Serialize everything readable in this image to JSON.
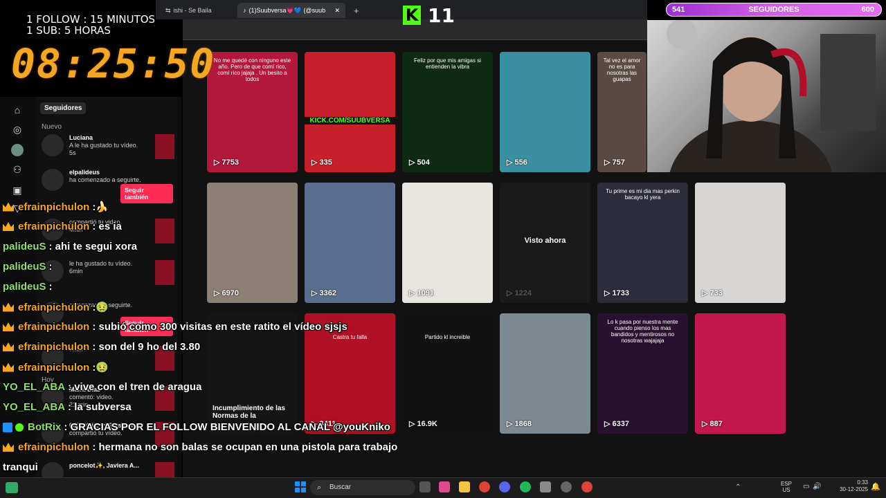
{
  "overlay": {
    "follow_line": "1 FOLLOW : 15 MINUTOS",
    "sub_line": "1 SUB: 5 HORAS",
    "timer": "08:25:50",
    "kick_count": "11",
    "goal": {
      "current": "541",
      "label": "SEGUIDORES",
      "target": "600",
      "progress_fraction": 0.9
    }
  },
  "browser": {
    "tabs": [
      {
        "label": "ishi - Se Baila"
      },
      {
        "label": "(1)Suubversa💗💙 (@suubversa)"
      }
    ],
    "new_tab": "+"
  },
  "sidebar": {
    "section": "Seguidores",
    "group_new": "Nuevo",
    "group_today": "Hoy",
    "notifications": [
      {
        "user": "Luciana",
        "text": "A le ha gustado tu vídeo.",
        "time": "5s"
      },
      {
        "user": "elpalideus",
        "text": "ha comenzado a seguirte.",
        "button": "Seguir también"
      },
      {
        "user": "",
        "text": "compartió tu video.",
        "time": "4min"
      },
      {
        "user": "",
        "text": "le ha gustado tu vídeo.",
        "time": "6min"
      },
      {
        "user": "",
        "text": "comenzado a seguirte.",
        "button": "Seguir también"
      },
      {
        "user": "",
        "text": "",
        "time": "7min"
      },
      {
        "user": "Maira Díaz",
        "text": "comentó: video.",
        "time": "21 min"
      },
      {
        "user": "080808.jk, , y 2 usuari...",
        "text": "compartió tu vídeo.",
        "time": ""
      },
      {
        "user": "poncelot✨, Javiera A...",
        "text": "",
        "time": ""
      }
    ]
  },
  "videos": [
    {
      "views": "7753",
      "caption": "No me quedé con ninguno este año. Pero de que comí rico, comí rico jajaja . Un besito a todos",
      "color": "#b3173a"
    },
    {
      "views": "335",
      "caption": "KICK.COM/SUUBVERSA",
      "color": "#c8202a"
    },
    {
      "views": "504",
      "caption": "Feliz por que mis amigas si entienden la vibra",
      "color": "#0f2a12"
    },
    {
      "views": "556",
      "caption": "",
      "color": "#3a8fa0"
    },
    {
      "views": "757",
      "caption": "Tal vez el amor no es para nosotras las guapas",
      "color": "#5a4a44"
    },
    {
      "views": "6970",
      "caption": "",
      "color": "#8c7f74"
    },
    {
      "views": "3362",
      "caption": "",
      "color": "#5a6f8f"
    },
    {
      "views": "1091",
      "caption": "",
      "color": "#e8e4df"
    },
    {
      "views": "1224",
      "caption": "Visto ahora",
      "color": "#1a1a1a"
    },
    {
      "views": "1733",
      "caption": "Tu prime es mi dia mas perkin bacayo kl yera",
      "color": "#2c2c3a"
    },
    {
      "views": "733",
      "caption": "",
      "color": "#d8d6d4"
    },
    {
      "views": "",
      "caption": "Incumplimiento de las Normas de la",
      "color": "#151515"
    },
    {
      "views": "3411",
      "caption": "Castra tu falla",
      "color": "#b01025"
    },
    {
      "views": "16.9K",
      "caption": "Partido kl increible",
      "color": "#111"
    },
    {
      "views": "1868",
      "caption": "",
      "color": "#7a8a90"
    },
    {
      "views": "6337",
      "caption": "Lo k pasa por nuestra mente cuando pienso los mas bandidos y mentirosos no nosotras wajajaja",
      "color": "#2a1030"
    },
    {
      "views": "887",
      "caption": "",
      "color": "#c2184d"
    }
  ],
  "chat": [
    {
      "user": "efrainpichulon",
      "badge": "crown",
      "text": ": ",
      "emote": "🍌",
      "color": "orange"
    },
    {
      "user": "efrainpichulon",
      "badge": "crown",
      "text": ": es ia",
      "color": "orange"
    },
    {
      "user": "palideuS",
      "badge": "",
      "text": ": ahi te segui xora",
      "color": "green"
    },
    {
      "user": "palideuS",
      "badge": "",
      "text": ":",
      "color": "green"
    },
    {
      "user": "palideuS",
      "badge": "",
      "text": ":",
      "color": "green"
    },
    {
      "user": "efrainpichulon",
      "badge": "crown",
      "text": ": ",
      "emote": "🤢",
      "color": "orange"
    },
    {
      "user": "efrainpichulon",
      "badge": "crown",
      "text": ": subió como 300 visitas en este ratito el vídeo sjsjs",
      "color": "orange"
    },
    {
      "user": "efrainpichulon",
      "badge": "crown",
      "text": ": son del 9 ho del 3.80",
      "color": "orange"
    },
    {
      "user": "efrainpichulon",
      "badge": "crown",
      "text": ": ",
      "emote": "🤢",
      "color": "orange"
    },
    {
      "user": "YO_EL_ABA",
      "badge": "",
      "text": ": vive con el tren de aragua",
      "color": "green"
    },
    {
      "user": "YO_EL_ABA",
      "badge": "",
      "text": ": la subversa",
      "color": "green"
    },
    {
      "user": "BotRix",
      "badge": "bot",
      "text": ": GRACIAS POR EL FOLLOW BIENVENIDO AL CANAL @youKniko",
      "color": "green"
    },
    {
      "user": "efrainpichulon",
      "badge": "crown",
      "text": ": hermana no son balas se ocupan en una pistola para trabajo",
      "color": "orange"
    },
    {
      "user": "",
      "badge": "",
      "text": "tranqui",
      "color": "orange"
    },
    {
      "user": "efrainpichulon",
      "badge": "crown",
      "text": ": ",
      "emote": "🐸",
      "color": "orange"
    }
  ],
  "taskbar": {
    "search_placeholder": "Buscar",
    "lang_top": "ESP",
    "lang_bottom": "US",
    "time": "0:33",
    "date": "30-12-2025"
  }
}
